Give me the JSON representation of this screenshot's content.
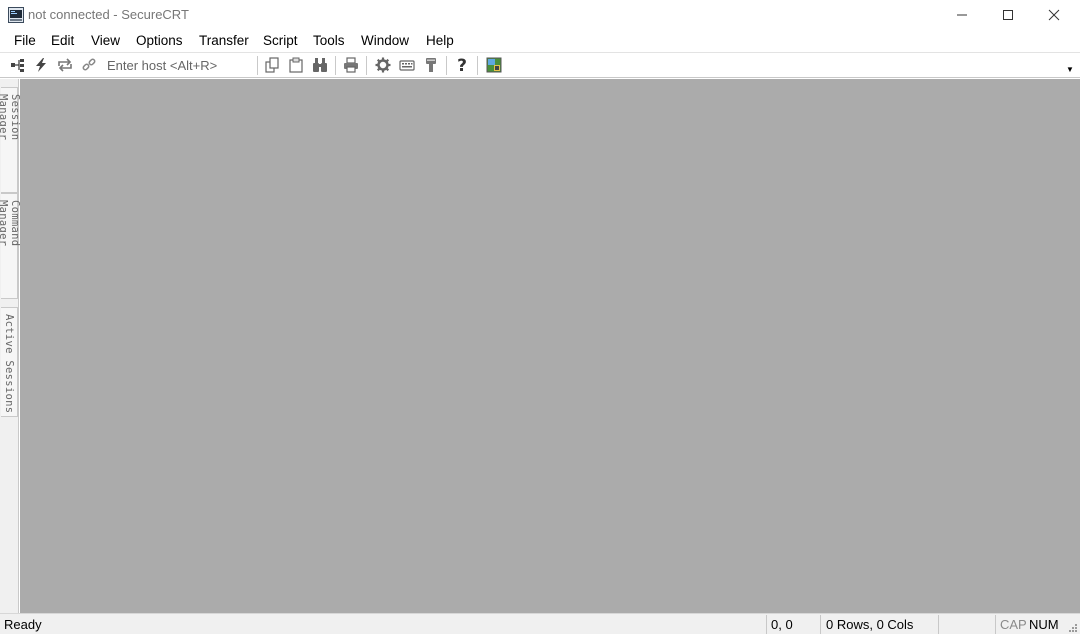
{
  "window": {
    "title": "not connected - SecureCRT"
  },
  "menu": {
    "items": [
      "File",
      "Edit",
      "View",
      "Options",
      "Transfer",
      "Script",
      "Tools",
      "Window",
      "Help"
    ]
  },
  "toolbar": {
    "host_placeholder": "Enter host <Alt+R>",
    "icons": [
      "connect-icon",
      "quick-connect-icon",
      "reconnect-icon",
      "disconnect-icon",
      "copy-icon",
      "paste-icon",
      "find-icon",
      "print-icon",
      "session-options-icon",
      "keymap-icon",
      "sftp-icon",
      "help-icon",
      "map-icon"
    ]
  },
  "sidetabs": {
    "session_manager": "Session Manager",
    "command_manager": "Command Manager",
    "active_sessions": "Active Sessions"
  },
  "status": {
    "ready": "Ready",
    "position": "0, 0",
    "size": "0 Rows, 0 Cols",
    "cap": "CAP",
    "num": "NUM"
  },
  "colors": {
    "workspace": "#ababab",
    "statusbar": "#f0f0f0",
    "title_text": "#777777"
  }
}
